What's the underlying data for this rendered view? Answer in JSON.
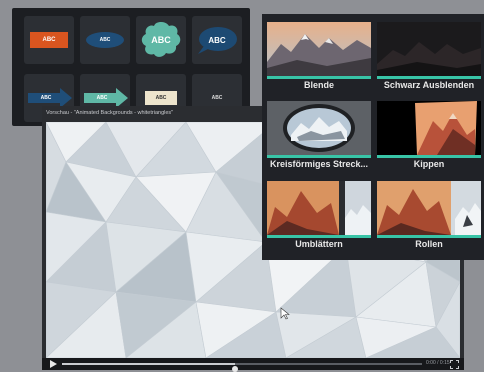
{
  "annotations": {
    "tiles": [
      {
        "id": "bubble-orange",
        "label": "ABC"
      },
      {
        "id": "callout-ellipse",
        "label": "ABC"
      },
      {
        "id": "speech-cloud",
        "label": "ABC"
      },
      {
        "id": "speech-bubble",
        "label": "ABC"
      },
      {
        "id": "arrow-blue",
        "label": "ABC"
      },
      {
        "id": "arrow-teal",
        "label": "ABC"
      },
      {
        "id": "note-sticky",
        "label": "ABC"
      },
      {
        "id": "text-plain",
        "label": "ABC"
      }
    ]
  },
  "transitions": {
    "accent_color": "#38c4a7",
    "items": [
      {
        "id": "blende",
        "label": "Blende"
      },
      {
        "id": "schwarz",
        "label": "Schwarz Ausblenden"
      },
      {
        "id": "kreis",
        "label": "Kreisförmiges Streck..."
      },
      {
        "id": "kippen",
        "label": "Kippen"
      },
      {
        "id": "umblaettern",
        "label": "Umblättern"
      },
      {
        "id": "rollen",
        "label": "Rollen"
      }
    ]
  },
  "preview": {
    "title": "Vorschau - \"Animated Backgrounds - whitetriangles\"",
    "timecode": "0:00 / 0:15",
    "progress": 0.48
  }
}
